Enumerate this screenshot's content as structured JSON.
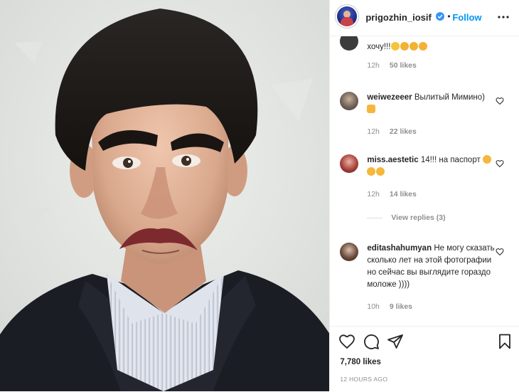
{
  "post": {
    "username": "prigozhin_iosif",
    "follow_label": "Follow",
    "dot": "•",
    "likes_count": "7,780 likes",
    "time_ago": "12 HOURS AGO"
  },
  "comments": [
    {
      "username": "",
      "text": "хочу!!!",
      "emoji": [
        "laugh",
        "clap",
        "clap",
        "clap"
      ],
      "time": "12h",
      "likes": "50 likes"
    },
    {
      "username": "weiwezeeer",
      "text": "Вылитый Мимино)",
      "emoji_line2": [
        "victory"
      ],
      "time": "12h",
      "likes": "22 likes"
    },
    {
      "username": "miss.aestetic",
      "text": "14!!! на паспорт",
      "emoji_inline": [
        "cat-joy"
      ],
      "emoji_line2": [
        "cat-joy",
        "cat-joy"
      ],
      "time": "12h",
      "likes": "14 likes"
    },
    {
      "username": "editashahumyan",
      "text": "Не могу сказать сколько лет на этой фотографии но сейчас вы выглядите гораздо моложе ))))",
      "time": "10h",
      "likes": "9 likes"
    }
  ],
  "view_replies": "View replies (3)",
  "colors": {
    "accent": "#0095f6",
    "muted": "#8e8e8e",
    "text": "#262626"
  },
  "icons": [
    "verified-badge-icon",
    "more-options-icon",
    "heart-icon",
    "comment-icon",
    "share-icon",
    "bookmark-icon"
  ]
}
